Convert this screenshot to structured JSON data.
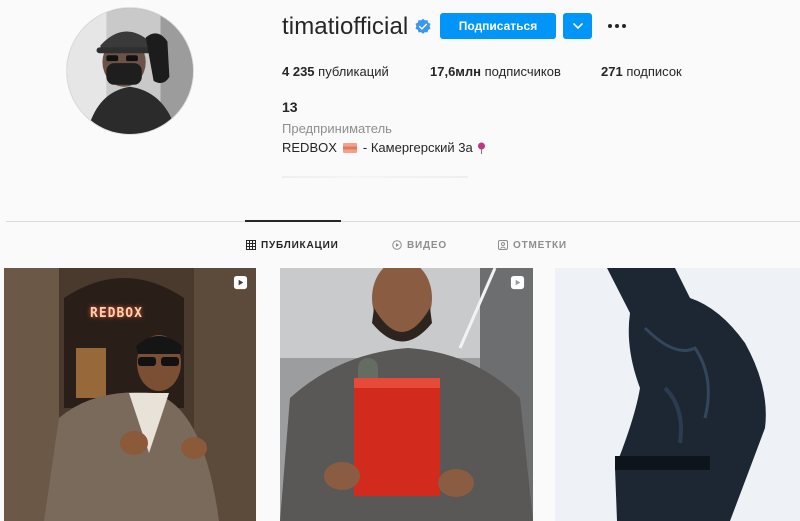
{
  "profile": {
    "username": "timatiofficial",
    "follow_label": "Подписаться",
    "stats": {
      "posts": "4 235",
      "posts_label": " публикаций",
      "followers": "17,6млн",
      "followers_label": " подписчиков",
      "following": "271",
      "following_label": " подписок"
    },
    "full_name": "13",
    "category": "Предприниматель",
    "bio_main": "REDBOX",
    "bio_rest": " - Камергерский 3а"
  },
  "tabs": [
    {
      "label": "ПУБЛИКАЦИИ",
      "icon": "grid-icon",
      "active": true
    },
    {
      "label": "ВИДЕО",
      "icon": "play-circle-icon",
      "active": false
    },
    {
      "label": "ОТМЕТКИ",
      "icon": "tag-icon",
      "active": false
    }
  ],
  "posts": [
    {
      "type": "reel",
      "sign_text": "REDBOX"
    },
    {
      "type": "reel"
    },
    {
      "type": "photo"
    }
  ],
  "colors": {
    "accent": "#0095f6",
    "text": "#262626",
    "muted": "#8e8e8e",
    "background": "#fafafa",
    "divider": "#dbdbdb"
  }
}
